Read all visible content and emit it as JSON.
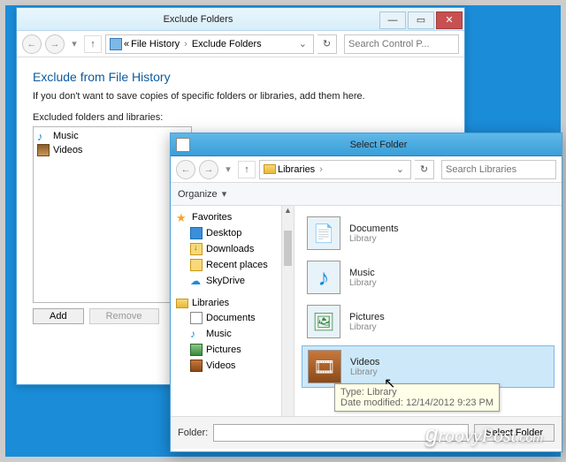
{
  "win1": {
    "title": "Exclude Folders",
    "breadcrumb": {
      "part1": "File History",
      "part2": "Exclude Folders",
      "sep": "›"
    },
    "search_placeholder": "Search Control P...",
    "heading": "Exclude from File History",
    "description": "If you don't want to save copies of specific folders or libraries, add them here.",
    "list_label": "Excluded folders and libraries:",
    "items": {
      "music": "Music",
      "videos": "Videos"
    },
    "buttons": {
      "add": "Add",
      "remove": "Remove"
    }
  },
  "win2": {
    "title": "Select Folder",
    "breadcrumb": {
      "part1": "Libraries",
      "sep": "›"
    },
    "search_placeholder": "Search Libraries",
    "organize": "Organize",
    "tree": {
      "favorites": "Favorites",
      "desktop": "Desktop",
      "downloads": "Downloads",
      "recent": "Recent places",
      "skydrive": "SkyDrive",
      "libraries": "Libraries",
      "documents": "Documents",
      "music": "Music",
      "pictures": "Pictures",
      "videos": "Videos"
    },
    "content": {
      "documents": {
        "name": "Documents",
        "sub": "Library"
      },
      "music": {
        "name": "Music",
        "sub": "Library"
      },
      "pictures": {
        "name": "Pictures",
        "sub": "Library"
      },
      "videos": {
        "name": "Videos",
        "sub": "Library"
      }
    },
    "tooltip": {
      "line1": "Type: Library",
      "line2": "Date modified: 12/14/2012 9:23 PM"
    },
    "footer": {
      "label": "Folder:",
      "button": "Select Folder"
    }
  },
  "watermark": "groovyPost",
  "watermark_suffix": ".com"
}
